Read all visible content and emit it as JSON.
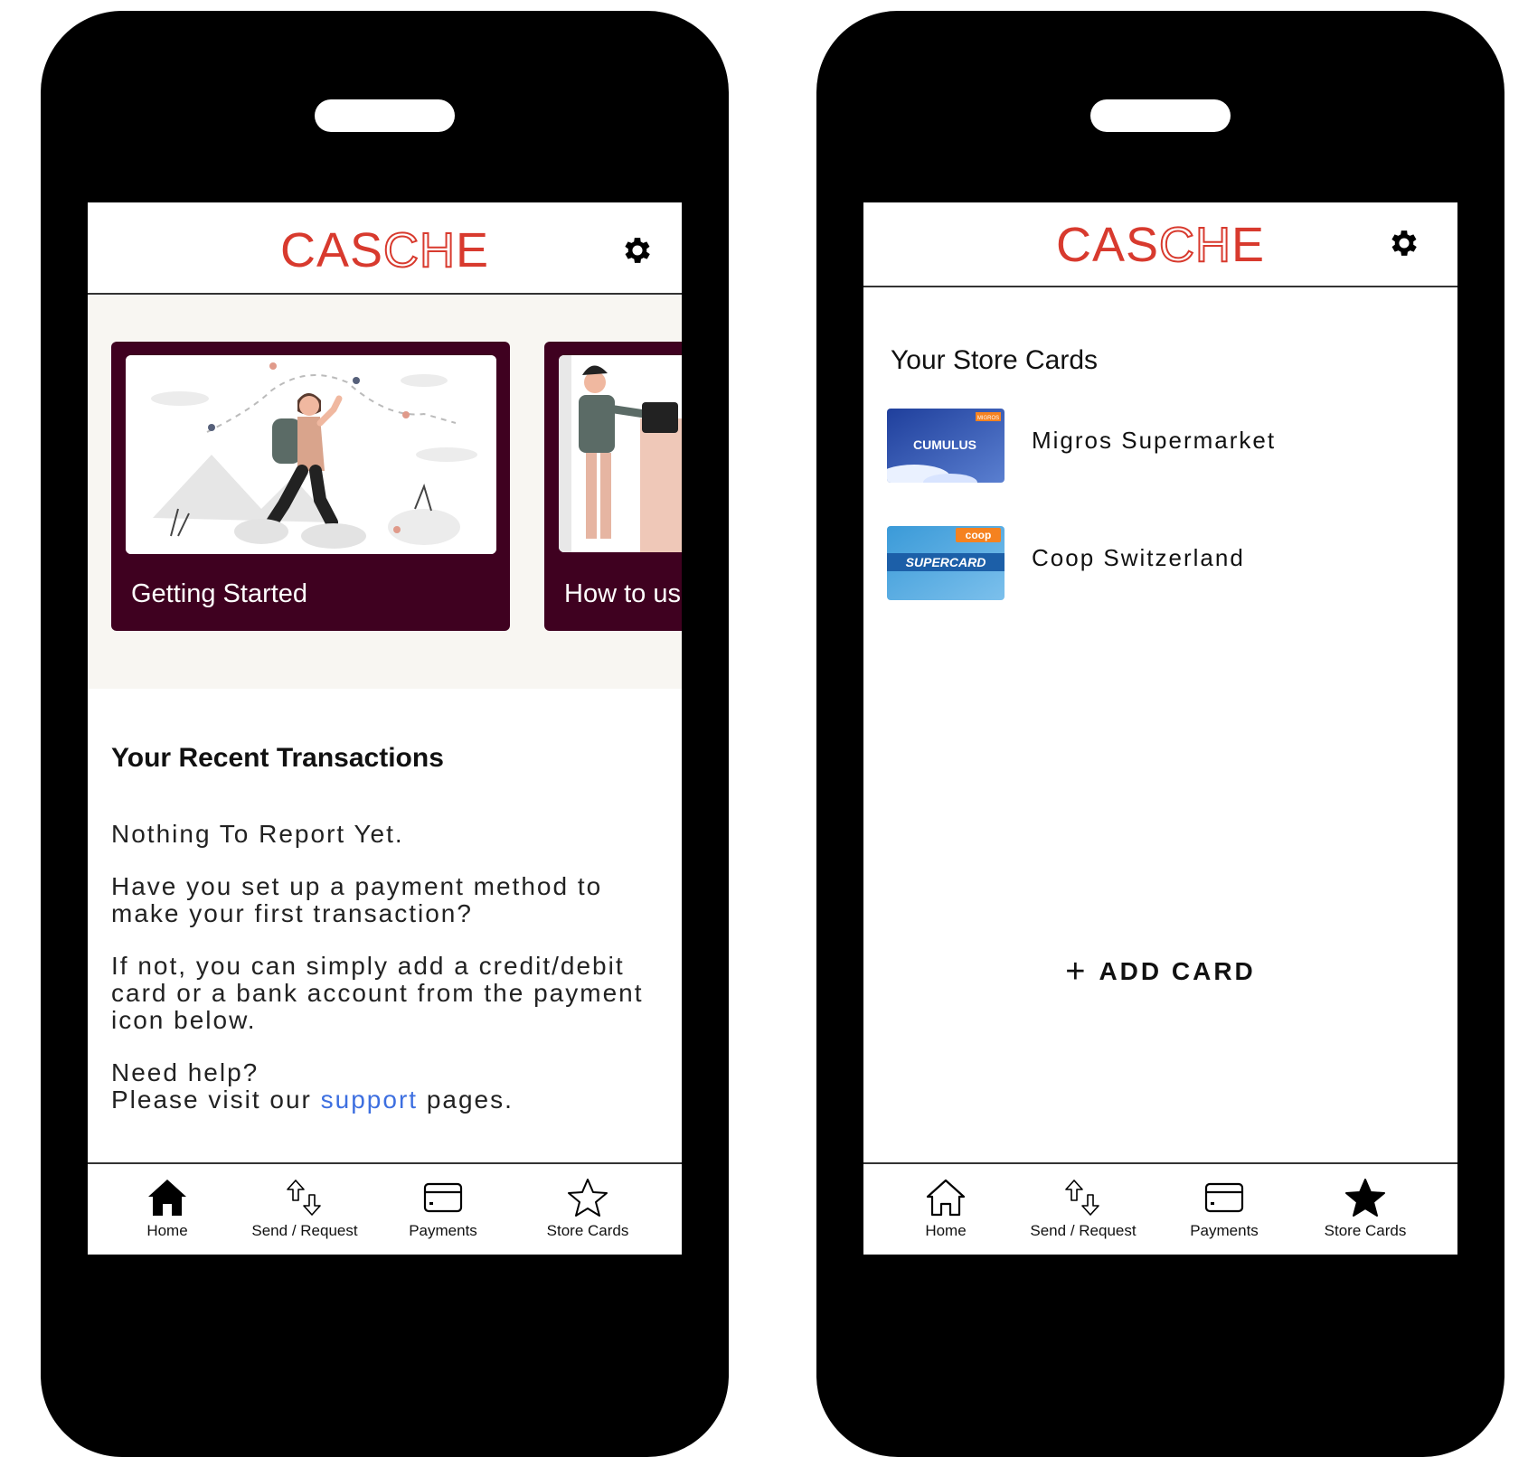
{
  "left_screen": {
    "logo": {
      "plain": "CAS",
      "outlined": "CH",
      "tail": "E"
    },
    "carousel": [
      {
        "label": "Getting Started"
      },
      {
        "label": "How to us"
      }
    ],
    "recent_title": "Your Recent Transactions",
    "message": {
      "line1": "Nothing To Report Yet.",
      "line2": "Have you set up a payment method to make your first transaction?",
      "line3": "If not, you can simply add a credit/debit card or a bank account from the payment icon below.",
      "help_line": "Need help?",
      "visit_prefix": "Please visit our",
      "support_link": "support",
      "visit_suffix": "pages."
    },
    "tabs": [
      {
        "label": "Home",
        "icon": "home-filled-icon"
      },
      {
        "label": "Send / Request",
        "icon": "send-request-icon"
      },
      {
        "label": "Payments",
        "icon": "credit-card-icon"
      },
      {
        "label": "Store Cards",
        "icon": "star-outline-icon"
      }
    ],
    "active_tab": "Home"
  },
  "right_screen": {
    "logo": {
      "plain": "CAS",
      "outlined": "CH",
      "tail": "E"
    },
    "title": "Your Store Cards",
    "cards": [
      {
        "name": "Migros Supermarket",
        "thumb_text": "CUMULUS",
        "thumb_brand": "MIGROS"
      },
      {
        "name": "Coop Switzerland",
        "thumb_text": "SUPERCARD",
        "thumb_brand": "coop"
      }
    ],
    "add_card_label": "ADD CARD",
    "tabs": [
      {
        "label": "Home",
        "icon": "home-outline-icon"
      },
      {
        "label": "Send / Request",
        "icon": "send-request-icon"
      },
      {
        "label": "Payments",
        "icon": "credit-card-icon"
      },
      {
        "label": "Store Cards",
        "icon": "star-filled-icon"
      }
    ],
    "active_tab": "Store Cards"
  },
  "colors": {
    "brand_red": "#d83a2e",
    "tile_maroon": "#3f0120",
    "link_blue": "#3d6fe0",
    "phone_frame": "#000000",
    "carousel_bg": "#f8f6f2"
  }
}
